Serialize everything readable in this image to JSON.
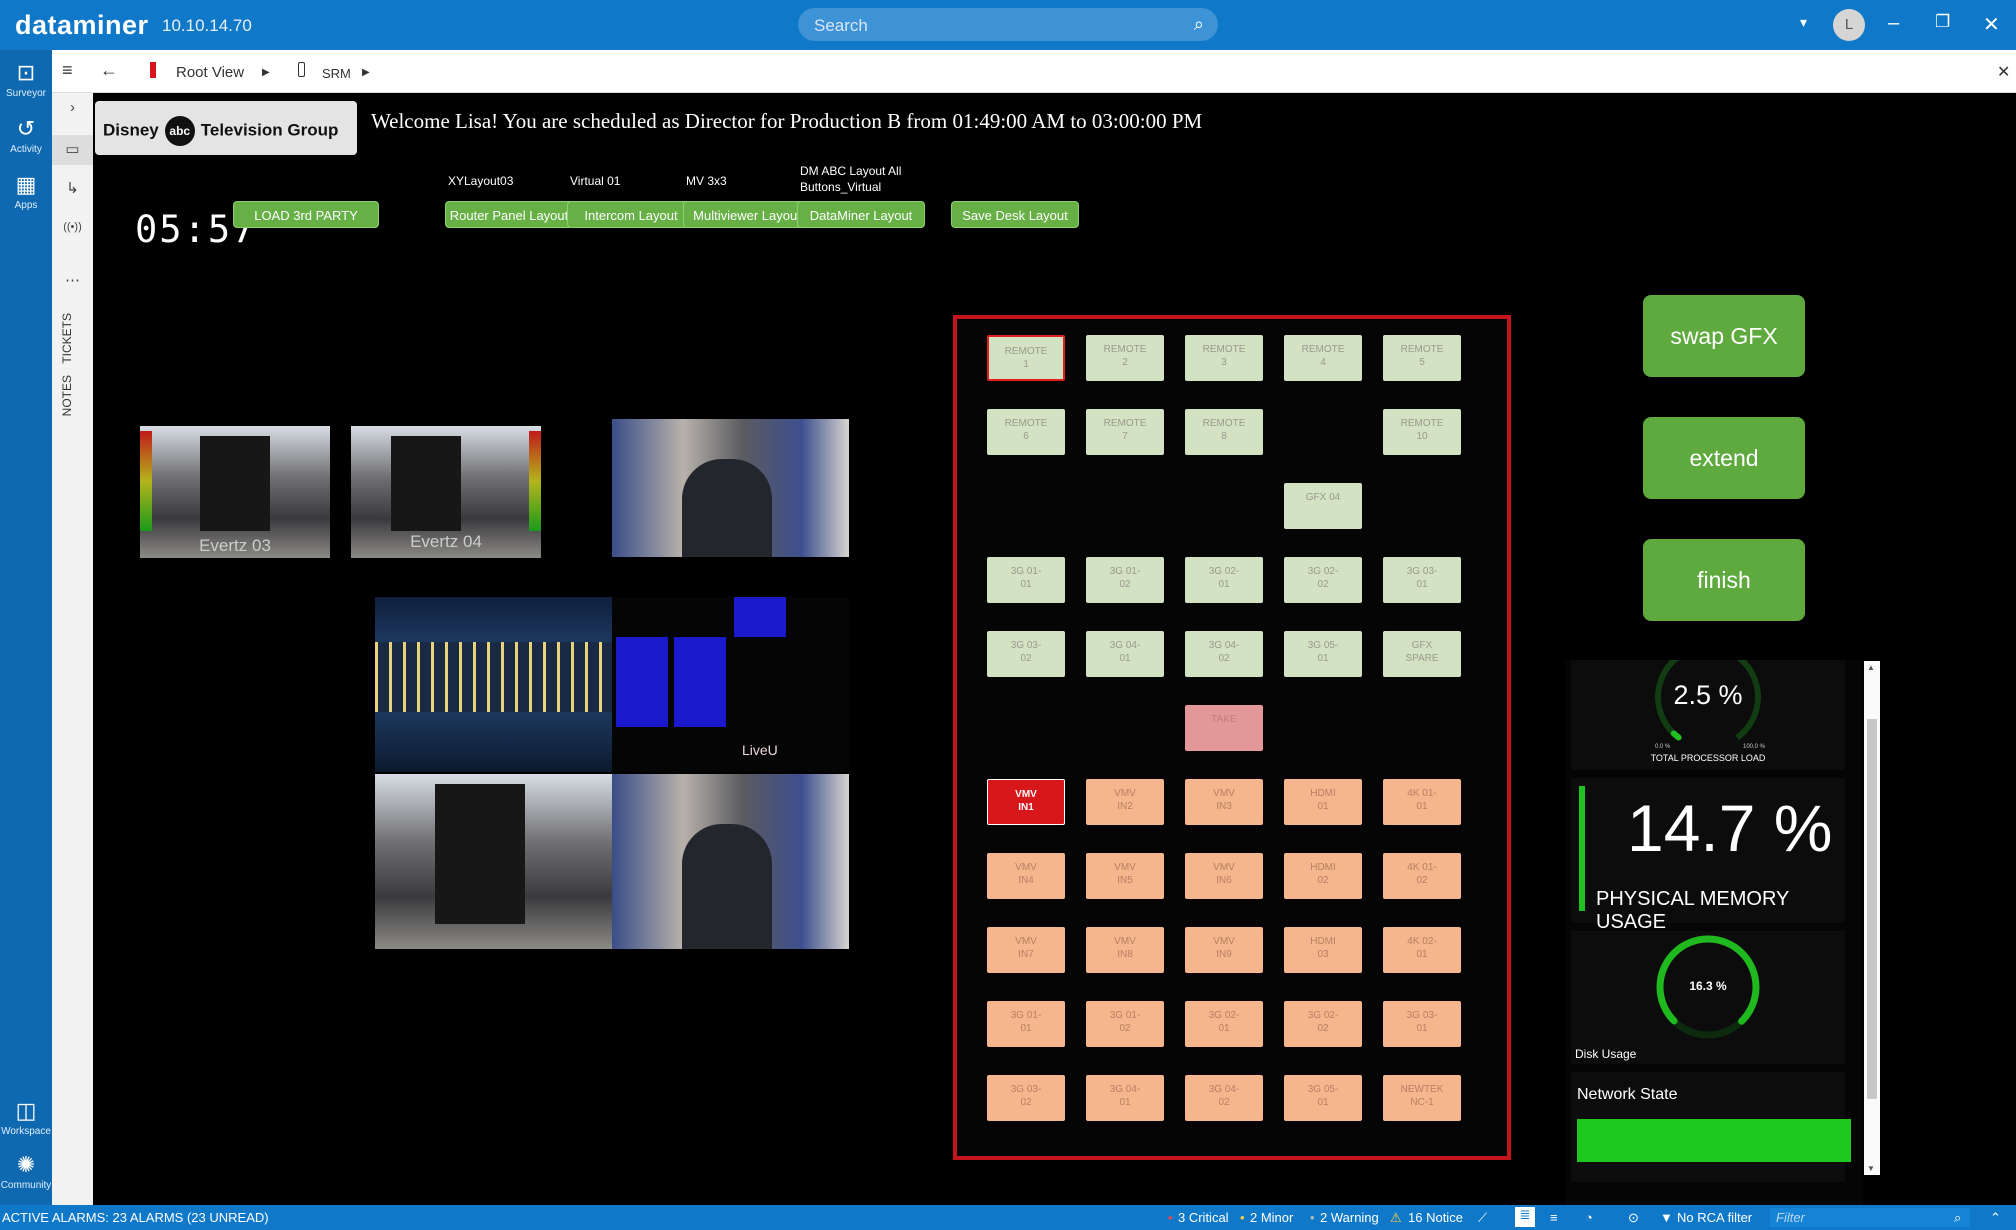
{
  "titlebar": {
    "brand": "dataminer",
    "ip": "10.10.14.70",
    "search_placeholder": "Search",
    "avatar": "L"
  },
  "nav": {
    "items": [
      {
        "label": "Surveyor"
      },
      {
        "label": "Activity"
      },
      {
        "label": "Apps"
      }
    ],
    "bottom": [
      {
        "label": "Workspace"
      },
      {
        "label": "Community"
      }
    ]
  },
  "sidepanel": {
    "tickets": "TICKETS",
    "notes": "NOTES"
  },
  "breadcrumb": {
    "root": "Root View",
    "child": "SRM"
  },
  "header": {
    "logo_brand": "Disney",
    "logo_abc": "abc",
    "logo_group": "Television Group",
    "welcome": "Welcome Lisa! You are scheduled as Director for Production B from 01:49:00 AM to 03:00:00 PM",
    "clock": "05:57"
  },
  "layouts": [
    {
      "caption": "",
      "label": "LOAD 3rd PARTY"
    },
    {
      "caption": "XYLayout03",
      "label": "Router Panel Layout"
    },
    {
      "caption": "Virtual 01",
      "label": "Intercom Layout"
    },
    {
      "caption": "MV 3x3",
      "label": "Multiviewer Layout"
    },
    {
      "caption": "DM ABC Layout All Buttons_Virtual",
      "label": "DataMiner Layout"
    },
    {
      "caption": "",
      "label": "Save Desk Layout"
    }
  ],
  "video": {
    "evertz03": "Evertz 03",
    "evertz04": "Evertz 04",
    "live": "LiveU"
  },
  "panel": {
    "rows": [
      [
        {
          "l": "REMOTE\n1",
          "c": "g",
          "sel": true
        },
        {
          "l": "REMOTE\n2",
          "c": "g"
        },
        {
          "l": "REMOTE\n3",
          "c": "g"
        },
        {
          "l": "REMOTE\n4",
          "c": "g"
        },
        {
          "l": "REMOTE\n5",
          "c": "g"
        }
      ],
      [
        {
          "l": "REMOTE\n6",
          "c": "g"
        },
        {
          "l": "REMOTE\n7",
          "c": "g"
        },
        {
          "l": "REMOTE\n8",
          "c": "g"
        },
        null,
        {
          "l": "REMOTE\n10",
          "c": "g"
        }
      ],
      [
        null,
        null,
        null,
        {
          "l": "GFX 04",
          "c": "g"
        },
        null
      ],
      [
        {
          "l": "3G 01-\n01",
          "c": "g"
        },
        {
          "l": "3G 01-\n02",
          "c": "g"
        },
        {
          "l": "3G 02-\n01",
          "c": "g"
        },
        {
          "l": "3G 02-\n02",
          "c": "g"
        },
        {
          "l": "3G 03-\n01",
          "c": "g"
        }
      ],
      [
        {
          "l": "3G 03-\n02",
          "c": "g"
        },
        {
          "l": "3G 04-\n01",
          "c": "g"
        },
        {
          "l": "3G 04-\n02",
          "c": "g"
        },
        {
          "l": "3G 05-\n01",
          "c": "g"
        },
        {
          "l": "GFX\nSPARE",
          "c": "g"
        }
      ],
      [
        null,
        null,
        {
          "l": "TAKE",
          "c": "p"
        },
        null,
        null
      ],
      [
        {
          "l": "VMV\nIN1",
          "c": "r"
        },
        {
          "l": "VMV\nIN2",
          "c": "o"
        },
        {
          "l": "VMV\nIN3",
          "c": "o"
        },
        {
          "l": "HDMI\n01",
          "c": "o"
        },
        {
          "l": "4K 01-\n01",
          "c": "o"
        }
      ],
      [
        {
          "l": "VMV\nIN4",
          "c": "o"
        },
        {
          "l": "VMV\nIN5",
          "c": "o"
        },
        {
          "l": "VMV\nIN6",
          "c": "o"
        },
        {
          "l": "HDMI\n02",
          "c": "o"
        },
        {
          "l": "4K 01-\n02",
          "c": "o"
        }
      ],
      [
        {
          "l": "VMV\nIN7",
          "c": "o"
        },
        {
          "l": "VMV\nIN8",
          "c": "o"
        },
        {
          "l": "VMV\nIN9",
          "c": "o"
        },
        {
          "l": "HDMI\n03",
          "c": "o"
        },
        {
          "l": "4K 02-\n01",
          "c": "o"
        }
      ],
      [
        {
          "l": "3G 01-\n01",
          "c": "o"
        },
        {
          "l": "3G 01-\n02",
          "c": "o"
        },
        {
          "l": "3G 02-\n01",
          "c": "o"
        },
        {
          "l": "3G 02-\n02",
          "c": "o"
        },
        {
          "l": "3G 03-\n01",
          "c": "o"
        }
      ],
      [
        {
          "l": "3G 03-\n02",
          "c": "o"
        },
        {
          "l": "3G 04-\n01",
          "c": "o"
        },
        {
          "l": "3G 04-\n02",
          "c": "o"
        },
        {
          "l": "3G 05-\n01",
          "c": "o"
        },
        {
          "l": "NEWTEK\nNC-1",
          "c": "o"
        }
      ]
    ]
  },
  "actions": {
    "swap": "swap GFX",
    "extend": "extend",
    "finish": "finish"
  },
  "stats": {
    "cpu": {
      "value": "2.5 %",
      "fraction": 0.025,
      "min": "0.0 %",
      "max": "100.0 %",
      "label": "TOTAL PROCESSOR LOAD"
    },
    "memory": {
      "value": "14.7 %",
      "fraction": 0.147,
      "label": "PHYSICAL MEMORY USAGE"
    },
    "disk": {
      "value": "16.3 %",
      "fraction": 0.163,
      "label": "Disk Usage"
    },
    "network": {
      "label": "Network State"
    }
  },
  "statusbar": {
    "alarms": "ACTIVE ALARMS: 23 ALARMS (23 UNREAD)",
    "critical": "3 Critical",
    "minor": "2 Minor",
    "warning": "2 Warning",
    "notice": "16 Notice",
    "rca": "No RCA filter",
    "filter": "Filter"
  },
  "colors": {
    "accent": "#0f78c8",
    "green": "#66b045",
    "panel_border": "#c3151b",
    "network_ok": "#1ec81e"
  }
}
